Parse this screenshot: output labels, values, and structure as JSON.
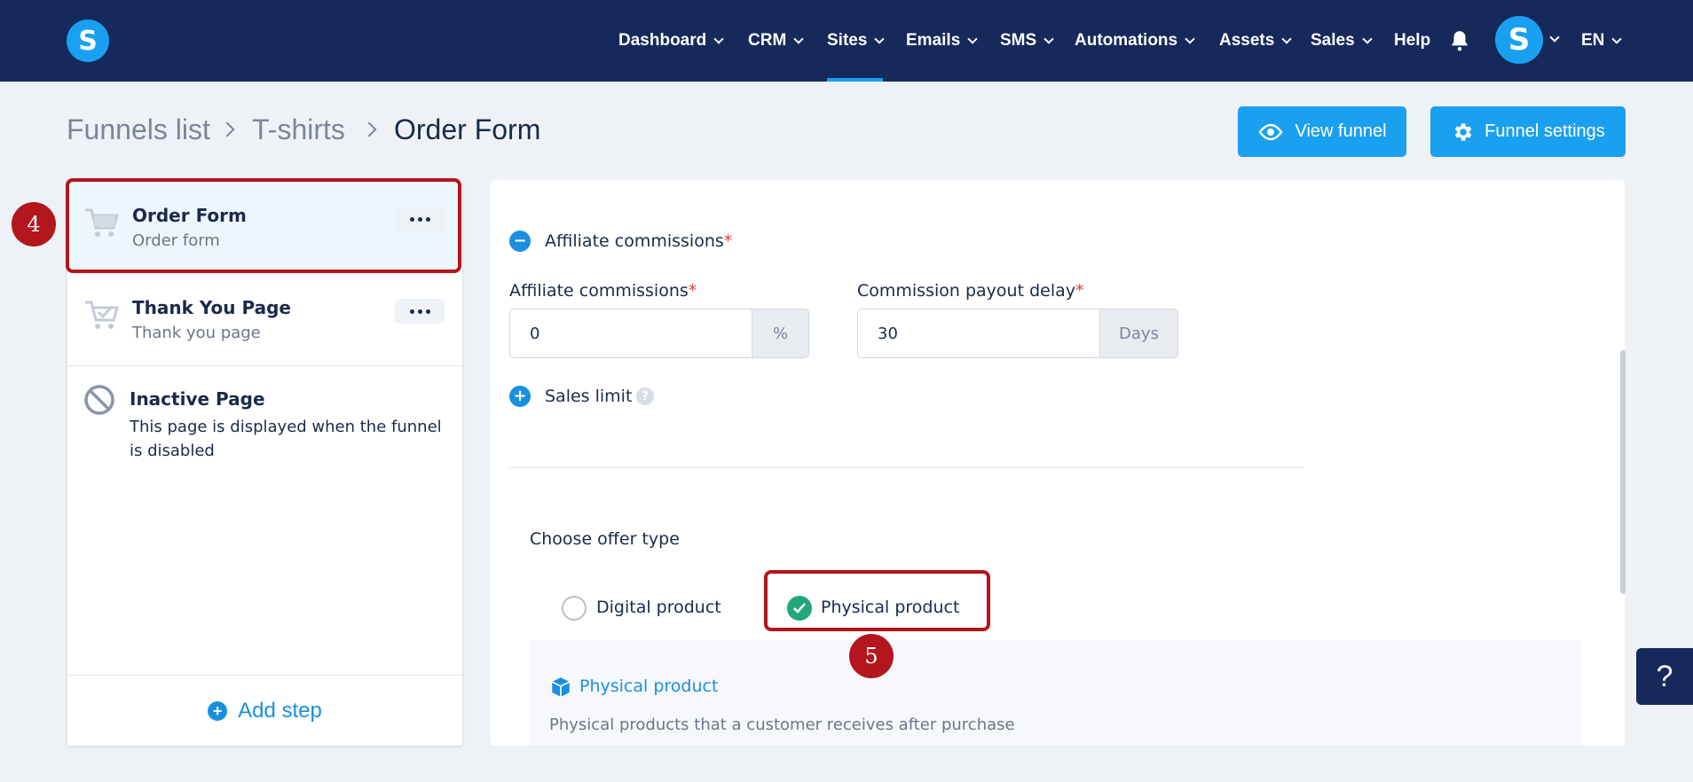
{
  "nav": {
    "items": [
      {
        "label": "Dashboard",
        "dropdown": true
      },
      {
        "label": "CRM",
        "dropdown": true
      },
      {
        "label": "Sites",
        "dropdown": true,
        "active": true
      },
      {
        "label": "Emails",
        "dropdown": true
      },
      {
        "label": "SMS",
        "dropdown": true
      },
      {
        "label": "Automations",
        "dropdown": true
      },
      {
        "label": "Assets",
        "dropdown": true
      },
      {
        "label": "Sales",
        "dropdown": true
      },
      {
        "label": "Help",
        "dropdown": false
      }
    ],
    "logo_letter": "S",
    "avatar_letter": "S",
    "language": "EN"
  },
  "breadcrumb": {
    "items": [
      "Funnels list",
      "T-shirts"
    ],
    "current": "Order Form"
  },
  "actions": {
    "view_funnel": "View funnel",
    "funnel_settings": "Funnel settings"
  },
  "steps": [
    {
      "title": "Order Form",
      "subtitle": "Order form",
      "icon": "cart-icon",
      "selected": true
    },
    {
      "title": "Thank You Page",
      "subtitle": "Thank you page",
      "icon": "cart-check-icon"
    },
    {
      "title": "Inactive Page",
      "subtitle": "This page is displayed when the funnel is disabled",
      "icon": "disabled-icon"
    }
  ],
  "add_step": "Add step",
  "form": {
    "affiliate_section": "Affiliate commissions",
    "affiliate_label": "Affiliate commissions",
    "affiliate_value": "0",
    "affiliate_suffix": "%",
    "payout_label": "Commission payout delay",
    "payout_value": "30",
    "payout_suffix": "Days",
    "sales_limit": "Sales limit",
    "required_mark": "*",
    "offer_type_label": "Choose offer type",
    "digital": "Digital product",
    "physical": "Physical product",
    "selected_offer": "Physical product",
    "info_title": "Physical product",
    "info_desc": "Physical products that a customer receives after purchase"
  },
  "annotations": {
    "badge_4": "4",
    "badge_5": "5"
  },
  "help_fab": "?",
  "colors": {
    "nav_bg": "#15295b",
    "accent": "#1aa0f0",
    "highlight": "#b3161d",
    "check": "#23a77a"
  }
}
